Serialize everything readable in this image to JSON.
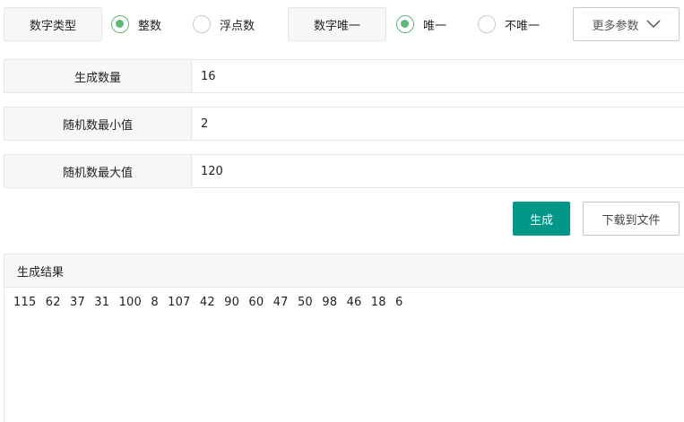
{
  "options": {
    "number_type": {
      "label": "数字类型",
      "choices": [
        {
          "label": "整数",
          "checked": true
        },
        {
          "label": "浮点数",
          "checked": false
        }
      ]
    },
    "uniqueness": {
      "label": "数字唯一",
      "choices": [
        {
          "label": "唯一",
          "checked": true
        },
        {
          "label": "不唯一",
          "checked": false
        }
      ]
    },
    "more_params_label": "更多参数"
  },
  "fields": {
    "count": {
      "label": "生成数量",
      "value": "16"
    },
    "min": {
      "label": "随机数最小值",
      "value": "2"
    },
    "max": {
      "label": "随机数最大值",
      "value": "120"
    }
  },
  "actions": {
    "generate_label": "生成",
    "download_label": "下载到文件"
  },
  "result": {
    "title": "生成结果",
    "text": "115 62 37 31 100 8 107 42 90 60 47 50 98 46 18 6"
  },
  "colors": {
    "primary": "#009688",
    "radio_checked": "#5fb878"
  },
  "icons": {
    "more_params": "chevron-down-icon"
  }
}
